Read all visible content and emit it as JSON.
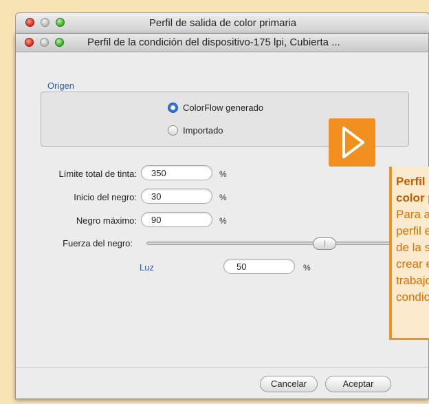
{
  "window_back": {
    "title": "Perfil de salida de color primaria"
  },
  "window": {
    "title": "Perfil de la condición del dispositivo-175 lpi, Cubierta ..."
  },
  "origin": {
    "label": "Origen",
    "options": [
      {
        "label": "ColorFlow generado",
        "selected": true
      },
      {
        "label": "Importado",
        "selected": false
      }
    ]
  },
  "fields": {
    "total_ink_limit": {
      "label": "Límite total de tinta:",
      "value": "350",
      "unit": "%"
    },
    "black_start": {
      "label": "Inicio del negro:",
      "value": "30",
      "unit": "%"
    },
    "max_black": {
      "label": "Negro máximo:",
      "value": "90",
      "unit": "%"
    },
    "black_strength": {
      "label": "Fuerza del negro:",
      "slider_level": 0.72
    },
    "light": {
      "label": "Luz",
      "value": "50",
      "unit": "%"
    }
  },
  "buttons": {
    "cancel": "Cancelar",
    "accept": "Aceptar"
  },
  "callout": {
    "heading_line1": "Perfil d",
    "heading_line2": "color p",
    "body_lines": [
      "Para ab",
      "perfil e",
      "de la sa",
      "crear e",
      "trabajo",
      "condici"
    ],
    "color": "#f0901e",
    "icon": "play-triangle-icon"
  }
}
